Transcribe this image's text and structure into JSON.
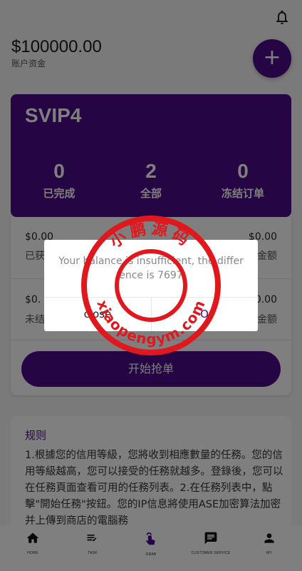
{
  "header": {
    "balance": "$100000.00",
    "balance_label": "账户资金",
    "bell_icon": "bell-icon",
    "add_icon": "plus-icon",
    "add_symbol": "+"
  },
  "vip": {
    "level": "SVIP4",
    "stats": [
      {
        "value": "0",
        "label": "已完成"
      },
      {
        "value": "2",
        "label": "全部"
      },
      {
        "value": "0",
        "label": "冻结订单"
      }
    ]
  },
  "panel": {
    "cells": [
      {
        "value": "$0.00",
        "label": "已获"
      },
      {
        "value": "$0.00",
        "label": "金额"
      },
      {
        "value": "$0.",
        "label": "未结"
      },
      {
        "value": "$0.00",
        "label": "金额"
      }
    ],
    "grab_button": "开始抢单"
  },
  "rules": {
    "title": "规则",
    "body": "1.根據您的信用等級，您將收到相應數量的任務。您的信用等級越高，您可以接受的任務就越多。登錄後，您可以在任務頁面查看可用的任務列表。2.在任務列表中，點擊\"開始任務\"按鈕。您的IP信息將使用ASE加密算法加密并上傳到商店的電腦務"
  },
  "dialog": {
    "message": "Your balance is insufficient, the difference is 7697",
    "close_label": "close",
    "ok_label": "O"
  },
  "watermark": {
    "top_text": "小鹏源码",
    "bottom_text": "xiaopengym.com"
  },
  "nav": {
    "items": [
      {
        "label": "HOME",
        "icon": "home-icon"
      },
      {
        "label": "TASK",
        "icon": "task-list-icon"
      },
      {
        "label": "GRAB",
        "icon": "grab-hand-icon"
      },
      {
        "label": "CUSTOMER SERVICE",
        "icon": "chat-icon"
      },
      {
        "label": "MY",
        "icon": "person-icon"
      }
    ]
  },
  "colors": {
    "brand": "#4b0b86",
    "stamp": "#e0181e"
  }
}
